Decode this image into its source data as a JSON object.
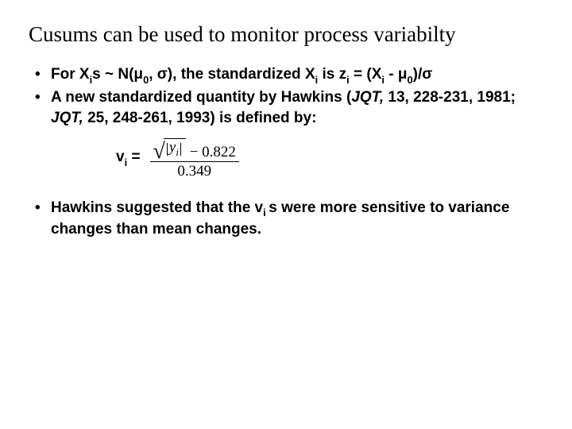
{
  "title": "Cusums can be used to monitor process variabilty",
  "bullet1": {
    "pre": "For X",
    "sub1": "i",
    "mid1": "s ~ N(μ",
    "sub2": "0",
    "mid2": ", σ), the standardized X",
    "sub3": "i",
    "mid3": " is z",
    "sub4": "i",
    "mid4": " = (X",
    "sub5": "i",
    "mid5": " - μ",
    "sub6": "0",
    "tail": ")/σ"
  },
  "bullet2": {
    "part1": " A new standardized quantity by Hawkins (",
    "jqt1": "JQT,",
    "part2": " 13, 228-231, 1981; ",
    "jqt2": "JQT,",
    "part3": " 25, 248-261, 1993) is  defined by:"
  },
  "formula": {
    "lhs_v": "v",
    "lhs_i": "i",
    "lhs_eq": " = ",
    "yi_y": "y",
    "yi_i": "i",
    "minus_const": " − 0.822",
    "denominator": "0.349"
  },
  "bullet3": {
    "part1": "Hawkins suggested that the v",
    "sub1": "i ",
    "part2": "s were more sensitive to variance changes than mean changes."
  }
}
